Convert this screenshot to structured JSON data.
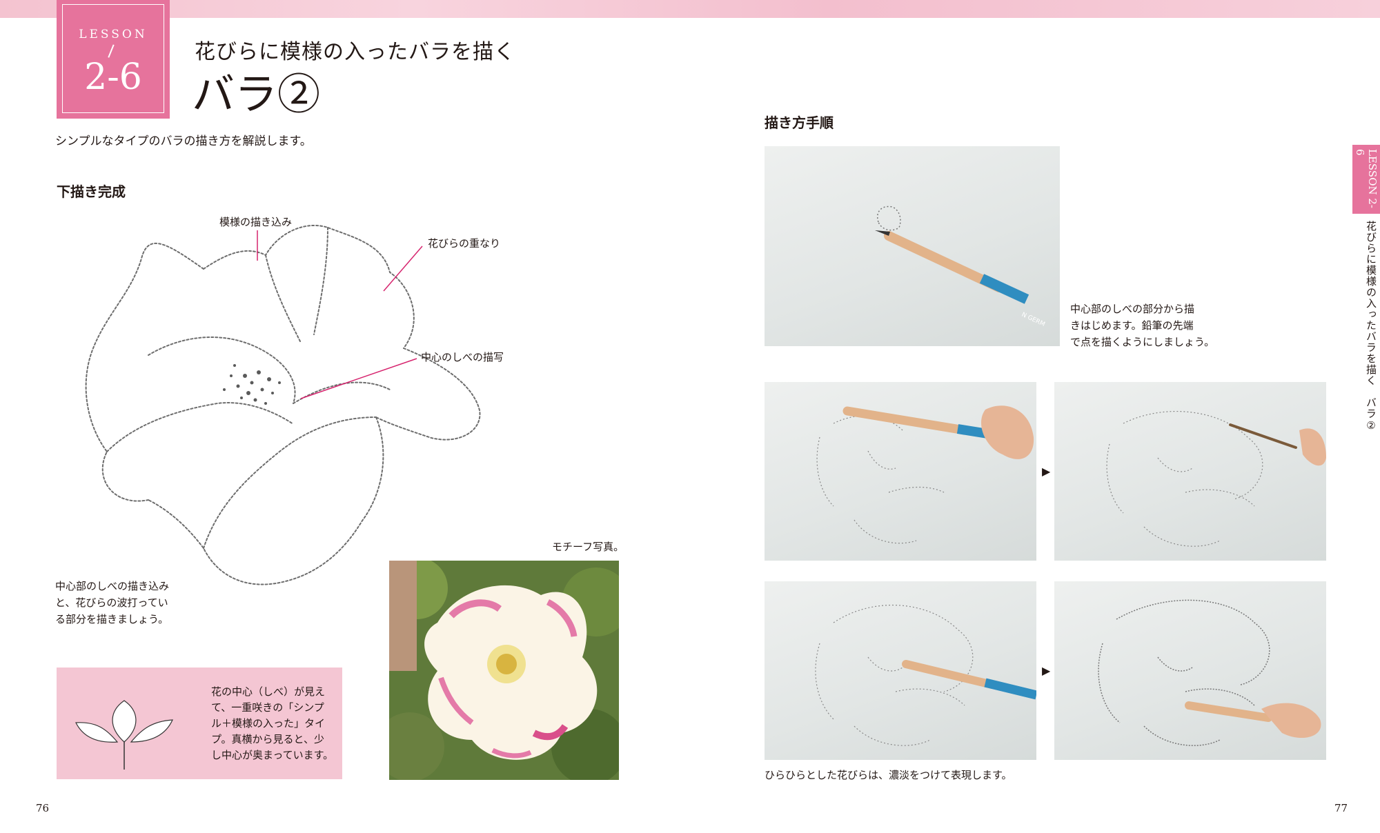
{
  "header": {
    "lesson_word": "LESSON",
    "lesson_number": "2-6",
    "subtitle": "花びらに模様の入ったバラを描く",
    "title": "バラ②"
  },
  "intro": "シンプルなタイプのバラの描き方を解説します。",
  "left": {
    "section_heading": "下描き完成",
    "labels": {
      "pattern": "模様の描き込み",
      "overlap": "花びらの重なり",
      "center": "中心のしべの描写"
    },
    "caption_lines": [
      "中心部のしべの描き込み",
      "と、花びらの波打ってい",
      "る部分を描きましょう。"
    ],
    "photo_caption": "モチーフ写真。",
    "tip_lines": [
      "花の中心（しべ）が見え",
      "て、一重咲きの「シンプ",
      "ル＋模様の入った」タイ",
      "プ。真横から見ると、少",
      "し中心が奥まっています。"
    ]
  },
  "right": {
    "section_heading": "描き方手順",
    "step1_caption_lines": [
      "中心部のしべの部分から描",
      "きはじめます。鉛筆の先端",
      "で点を描くようにしましょう。"
    ],
    "bottom_caption": "ひらひらとした花びらは、濃淡をつけて表現します。",
    "pencil_text": "N GERM"
  },
  "side": {
    "tab_label": "LESSON 2-6",
    "running_title": "花びらに模様の入ったバラを描く　バラ②"
  },
  "page_numbers": {
    "left": "76",
    "right": "77"
  },
  "colors": {
    "accent": "#e6739c",
    "pink_box": "#f4c6d3",
    "leader_line": "#d6246e"
  },
  "icons": {
    "step_arrow": "▶"
  }
}
